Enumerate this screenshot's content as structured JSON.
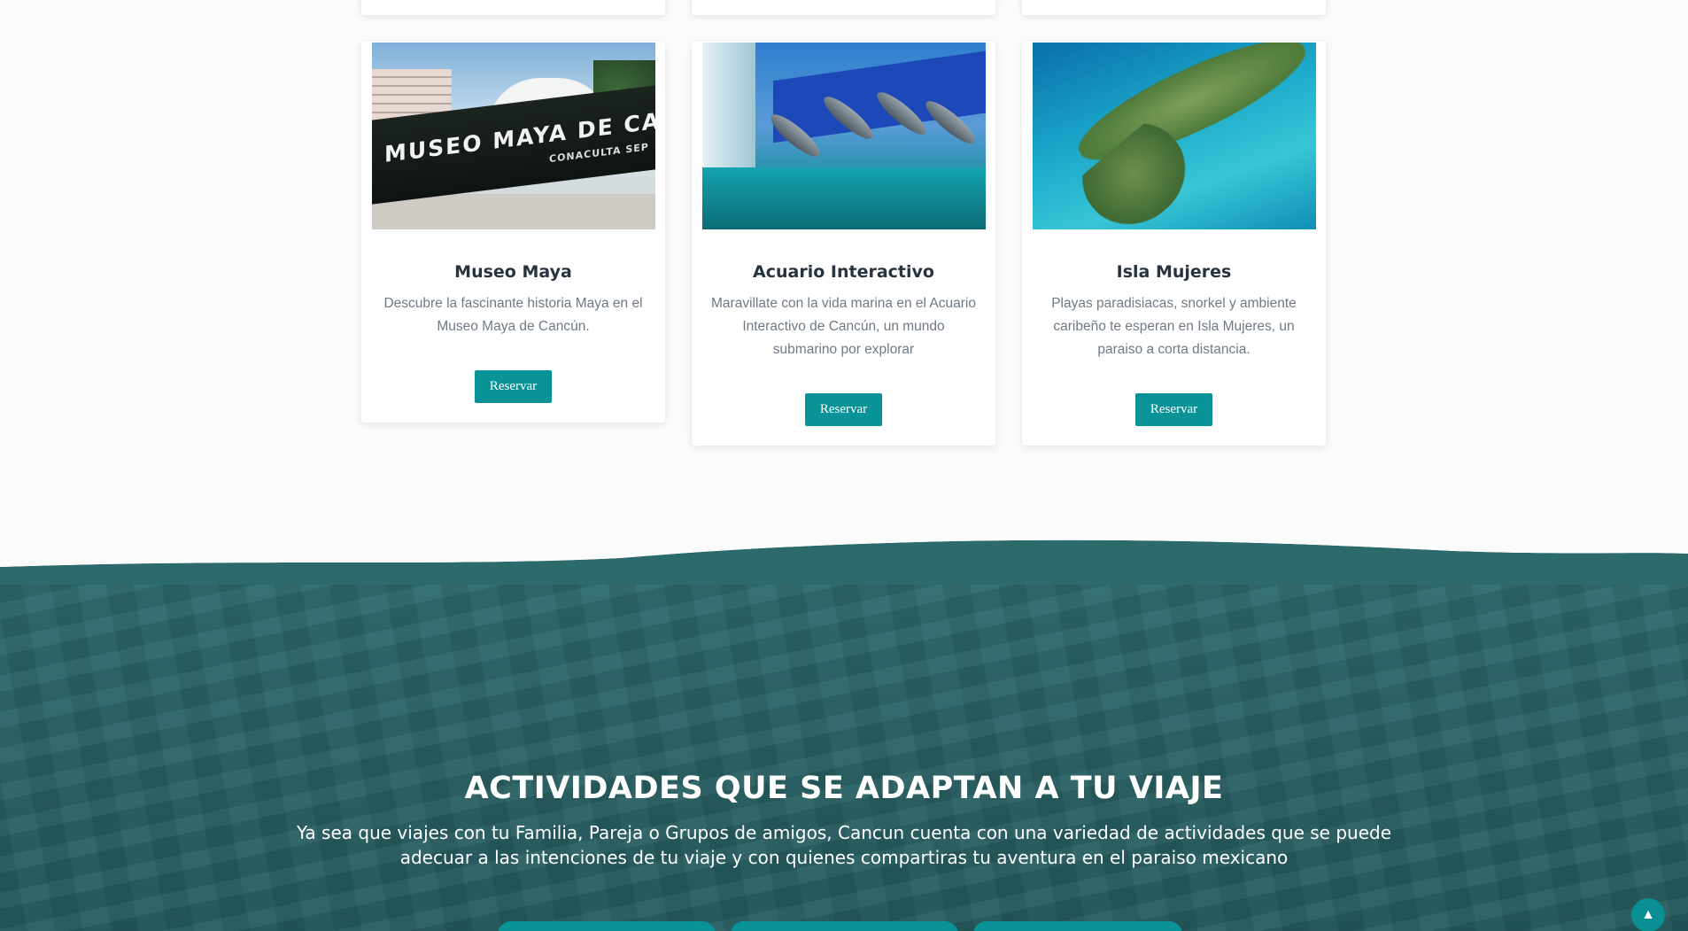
{
  "cards": [
    {
      "title": "Museo Maya",
      "description": "Descubre la fascinante historia Maya en el Museo Maya de Cancún.",
      "button_label": "Reservar",
      "image_text": "MUSEO MAYA DE CANCÚN",
      "image_subtext": "CONACULTA   SEP"
    },
    {
      "title": "Acuario Interactivo",
      "description": "Maravillate con la vida marina en el Acuario Interactivo de Cancún, un mundo submarino por explorar",
      "button_label": "Reservar"
    },
    {
      "title": "Isla Mujeres",
      "description": "Playas paradisiacas, snorkel y ambiente caribeño te esperan en Isla Mujeres, un paraiso a corta distancia.",
      "button_label": "Reservar"
    }
  ],
  "activities": {
    "heading": "ACTIVIDADES QUE SE ADAPTAN A TU VIAJE",
    "description": "Ya sea que viajes con tu Familia, Pareja o Grupos de amigos, Cancun cuenta con una variedad de actividades que se puede adecuar a las intenciones de tu viaje y con quienes compartiras tu aventura en el paraiso mexicano"
  },
  "icons": {
    "scroll_top": "chevron-up-icon"
  },
  "colors": {
    "accent": "#0a9396",
    "teal_bg": "#285f62",
    "title": "#27333f",
    "body_text": "#6f7a85"
  }
}
